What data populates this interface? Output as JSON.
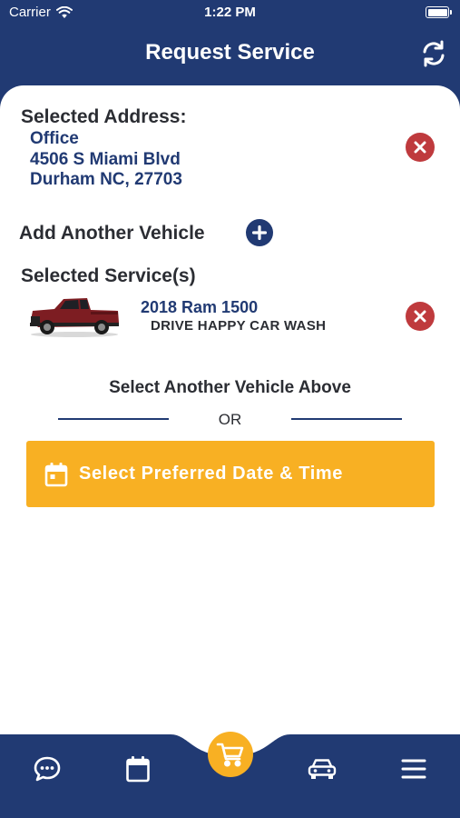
{
  "status_bar": {
    "carrier": "Carrier",
    "time": "1:22 PM"
  },
  "header": {
    "title": "Request Service"
  },
  "address": {
    "label": "Selected Address:",
    "name": "Office",
    "street": "4506 S Miami Blvd",
    "city": "Durham NC, 27703"
  },
  "add_vehicle": {
    "label": "Add Another Vehicle"
  },
  "services": {
    "label": "Selected Service(s)",
    "items": [
      {
        "vehicle": "2018 Ram 1500",
        "service": "DRIVE HAPPY CAR WASH"
      }
    ]
  },
  "select_vehicle_text": "Select Another Vehicle Above",
  "or_text": "OR",
  "date_button": {
    "label": "Select Preferred Date & Time"
  },
  "tab_bar": {
    "items": [
      {
        "icon": "chat-icon"
      },
      {
        "icon": "calendar-icon"
      },
      {
        "icon": "cart-icon",
        "active": true
      },
      {
        "icon": "car-icon"
      },
      {
        "icon": "menu-icon"
      }
    ]
  },
  "colors": {
    "navy": "#213a73",
    "accent": "#f8b023",
    "remove": "#bf3a3d",
    "text": "#2b2d33"
  }
}
